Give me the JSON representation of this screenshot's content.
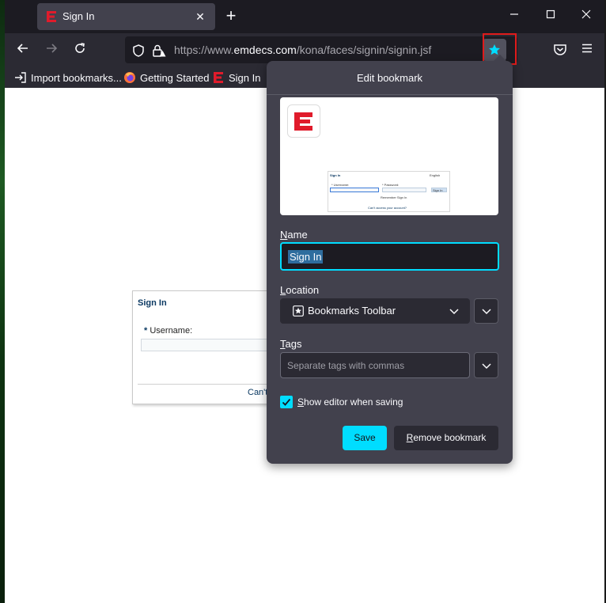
{
  "tab": {
    "title": "Sign In",
    "close_glyph": "✕"
  },
  "window": {
    "minimize": "—",
    "maximize": "☐",
    "close": "✕",
    "new_tab": "+"
  },
  "nav": {
    "url_prefix": "https://www.",
    "url_domain": "emdecs.com",
    "url_path": "/kona/faces/signin/signin.jsf"
  },
  "bookmarks_toolbar": {
    "items": [
      {
        "label": "Import bookmarks...",
        "icon": "import-icon"
      },
      {
        "label": "Getting Started",
        "icon": "firefox-icon"
      },
      {
        "label": "Sign In",
        "icon": "emdecs-favicon"
      }
    ]
  },
  "page": {
    "signin_title": "Sign In",
    "username_required": "*",
    "username_label": "Username:",
    "cant_access": "Can't"
  },
  "preview_mini": {
    "title": "Sign In",
    "lang": "English",
    "username": "* Username:",
    "password": "* Password:",
    "remember": "Remember Sign In",
    "signin_btn": "Sign In",
    "cant": "Can't access your account?"
  },
  "panel": {
    "title": "Edit bookmark",
    "name_label_u": "N",
    "name_label_rest": "ame",
    "name_value": "Sign In",
    "location_label_u": "L",
    "location_label_rest": "ocation",
    "location_value": "Bookmarks Toolbar",
    "tags_label_u": "T",
    "tags_label_rest": "ags",
    "tags_placeholder": "Separate tags with commas",
    "show_editor_u": "S",
    "show_editor_rest": "how editor when saving",
    "save_label": "Save",
    "remove_u": "R",
    "remove_rest": "emove bookmark"
  },
  "colors": {
    "accent": "#00ddff",
    "panel_bg": "#42414d",
    "brand_red": "#e01b2b",
    "highlight_box": "#e01b1b"
  }
}
